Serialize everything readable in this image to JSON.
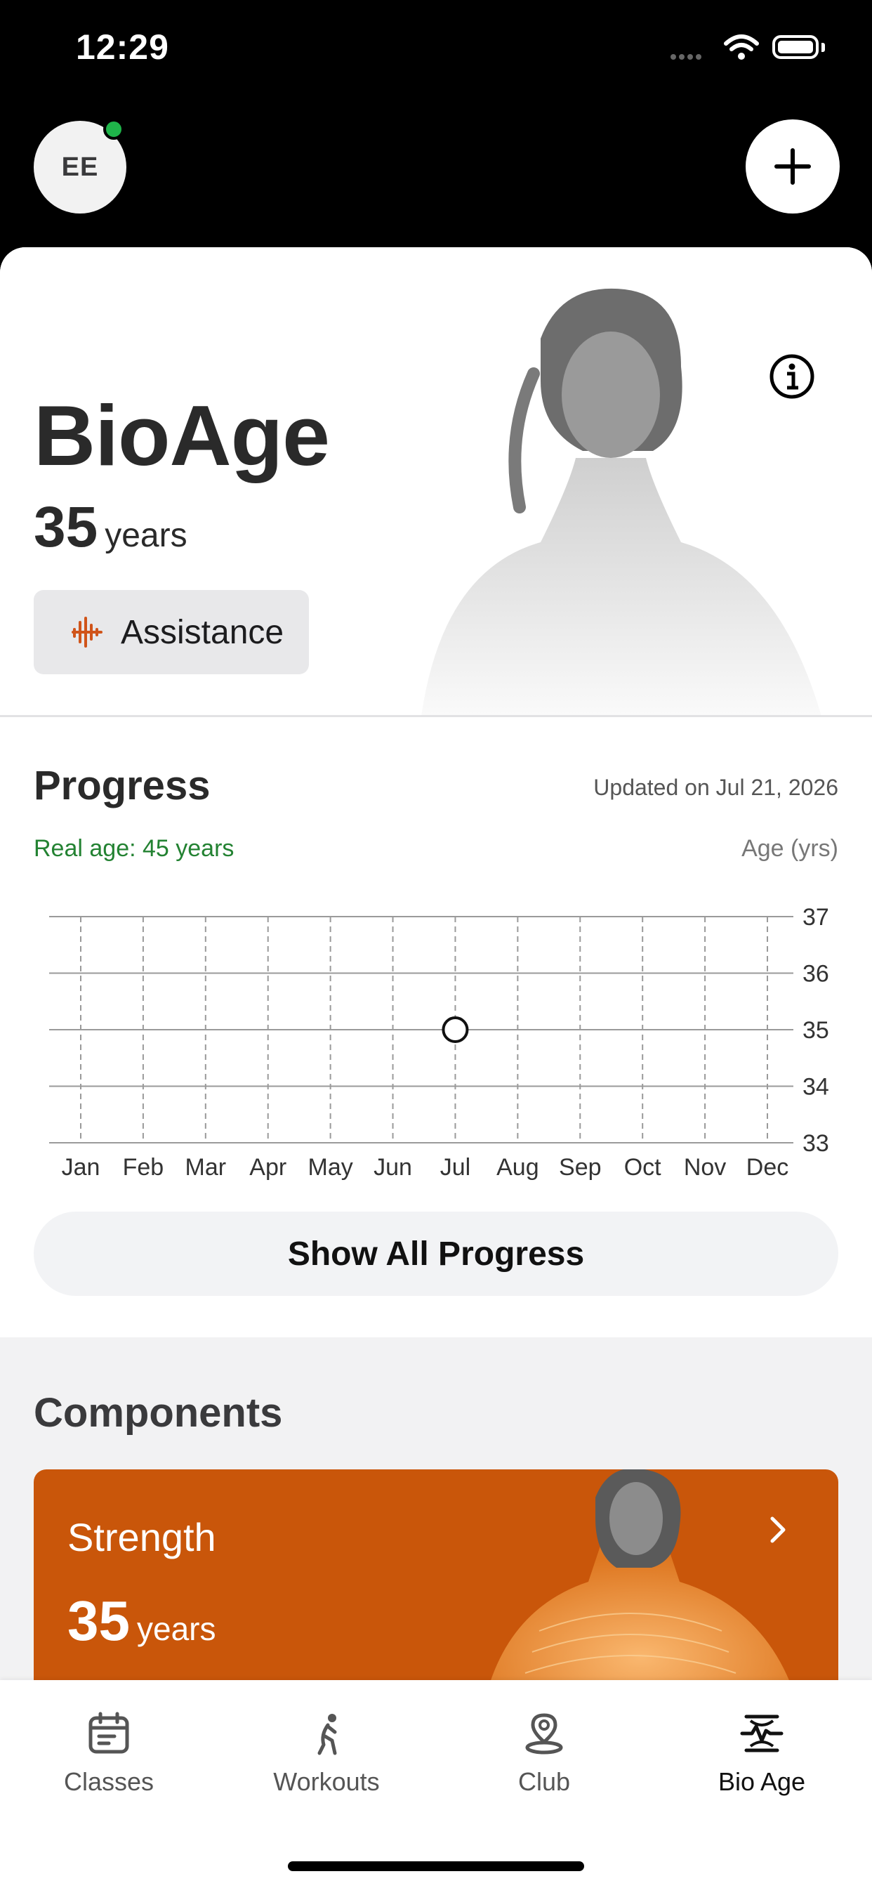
{
  "status_bar": {
    "time": "12:29"
  },
  "header": {
    "avatar_initials": "EE"
  },
  "hero": {
    "title": "BioAge",
    "age_value": "35",
    "age_unit": "years",
    "assistance_label": "Assistance"
  },
  "progress": {
    "title": "Progress",
    "updated": "Updated on Jul 21, 2026",
    "real_age": "Real age: 45 years",
    "axis_unit": "Age (yrs)",
    "show_all_label": "Show All Progress"
  },
  "chart_data": {
    "type": "scatter",
    "categories": [
      "Jan",
      "Feb",
      "Mar",
      "Apr",
      "May",
      "Jun",
      "Jul",
      "Aug",
      "Sep",
      "Oct",
      "Nov",
      "Dec"
    ],
    "points": [
      {
        "x": "Jul",
        "y": 35
      }
    ],
    "y_ticks": [
      "37",
      "36",
      "35",
      "34",
      "33"
    ],
    "ylim": [
      33,
      37
    ],
    "ylabel": "Age (yrs)",
    "grid": true,
    "y_axis_position": "right"
  },
  "components": {
    "title": "Components",
    "items": [
      {
        "label": "Strength",
        "age_value": "35",
        "age_unit": "years",
        "color": "#c9560a"
      }
    ]
  },
  "tabbar": {
    "tabs": [
      {
        "label": "Classes",
        "icon": "calendar-icon"
      },
      {
        "label": "Workouts",
        "icon": "runner-icon"
      },
      {
        "label": "Club",
        "icon": "location-pin-icon"
      },
      {
        "label": "Bio Age",
        "icon": "heartbeat-icon",
        "active": true
      }
    ]
  },
  "colors": {
    "accent": "#c9560a",
    "real_age_green": "#238232",
    "online": "#1fb54a"
  }
}
